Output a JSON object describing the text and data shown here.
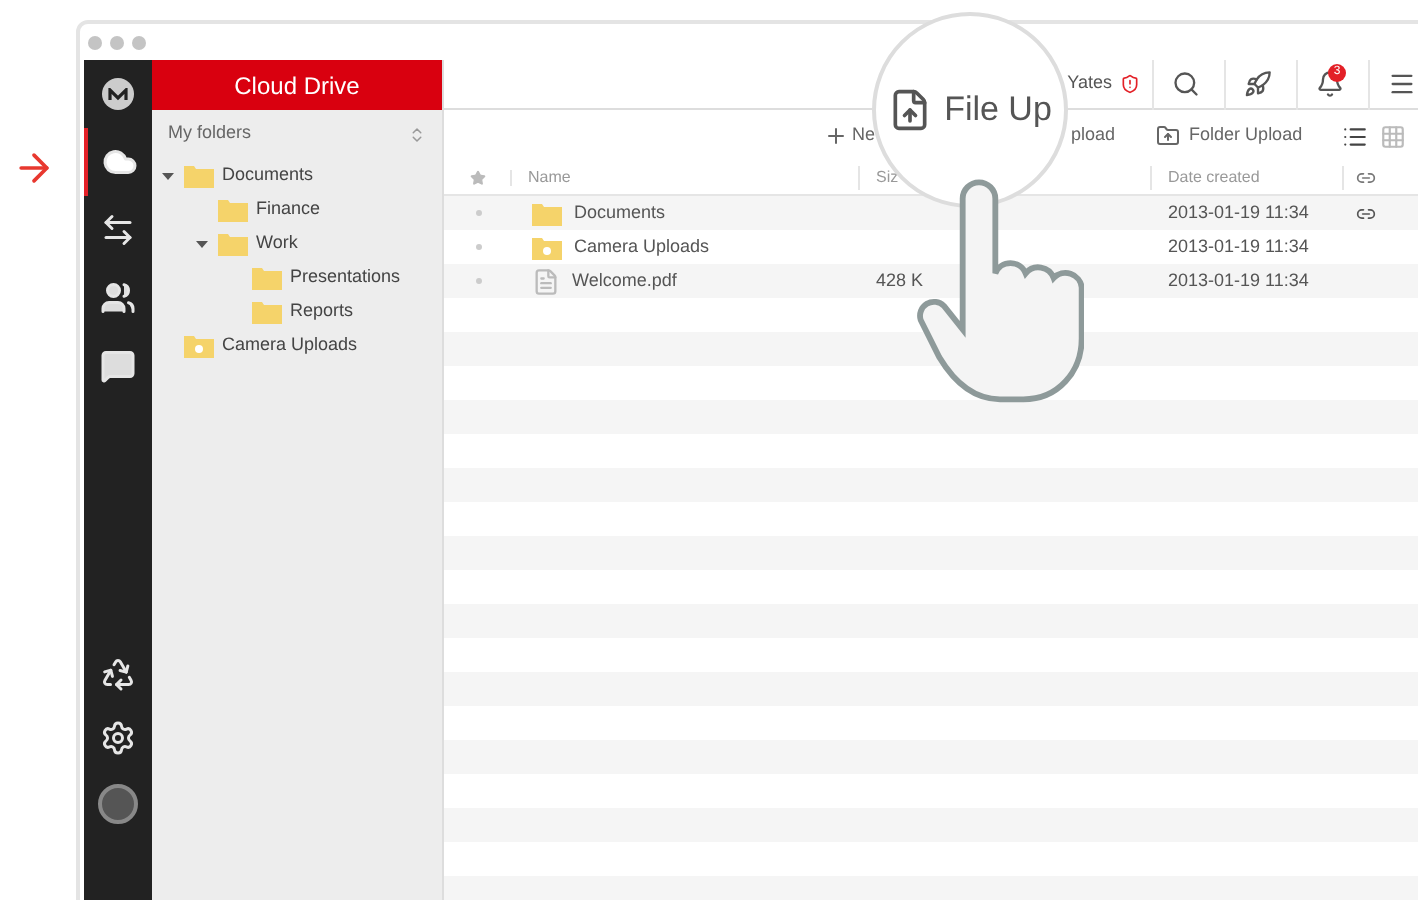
{
  "sidebar": {
    "items": [
      {
        "kind": "cloud",
        "selected": true
      },
      {
        "kind": "transfers",
        "selected": false
      },
      {
        "kind": "contacts",
        "selected": false
      },
      {
        "kind": "chat",
        "selected": false
      }
    ],
    "bottom": [
      {
        "kind": "rubbish"
      },
      {
        "kind": "settings"
      },
      {
        "kind": "avatar"
      }
    ]
  },
  "header": {
    "title": "Cloud Drive"
  },
  "tree": {
    "title": "My folders",
    "items": [
      {
        "label": "Documents",
        "kind": "folder",
        "expanded": true,
        "children": [
          {
            "label": "Finance",
            "kind": "folder"
          },
          {
            "label": "Work",
            "kind": "folder",
            "expanded": true,
            "children": [
              {
                "label": "Presentations",
                "kind": "folder"
              },
              {
                "label": "Reports",
                "kind": "folder"
              }
            ]
          }
        ]
      },
      {
        "label": "Camera Uploads",
        "kind": "camera"
      }
    ]
  },
  "topbar": {
    "user": "Yates",
    "notifications": "3"
  },
  "toolbar": {
    "new_label": "Ne",
    "upload_fragment": "pload",
    "folder_upload": "Folder Upload"
  },
  "table": {
    "columns": [
      "Name",
      "Siz",
      "Date created"
    ],
    "rows": [
      {
        "kind": "folder",
        "name": "Documents",
        "size": "",
        "date": "2013-01-19 11:34",
        "linked": true
      },
      {
        "kind": "camera",
        "name": "Camera Uploads",
        "size": "",
        "date": "2013-01-19 11:34",
        "linked": false
      },
      {
        "kind": "pdf",
        "name": "Welcome.pdf",
        "size": "428 K",
        "date": "2013-01-19 11:34",
        "linked": false
      }
    ]
  },
  "magnifier": {
    "text": "File Up"
  }
}
